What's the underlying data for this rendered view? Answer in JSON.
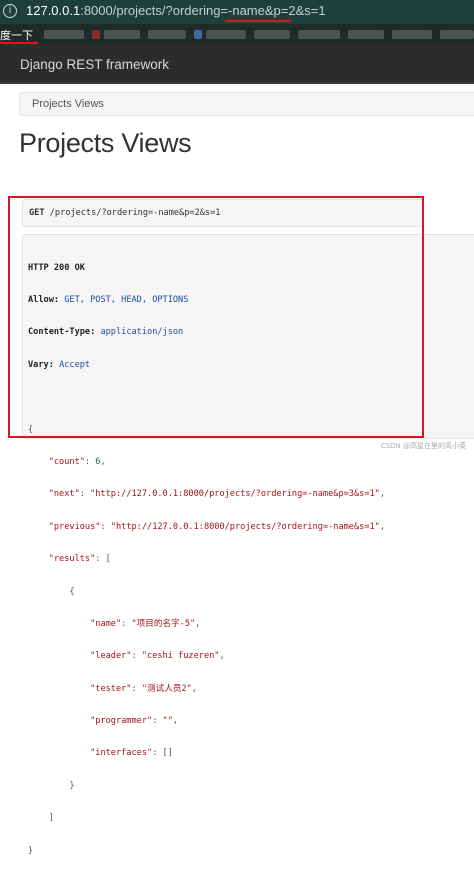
{
  "browser": {
    "url_host": "127.0.0.1",
    "url_path": ":8000/projects/?ordering=-name&p=2&s=1",
    "bookmark_first": "度一下"
  },
  "navbar": {
    "brand": "Django REST framework"
  },
  "breadcrumb": {
    "label": "Projects Views"
  },
  "page": {
    "title": "Projects Views"
  },
  "request": {
    "method": "GET",
    "path": "/projects/?ordering=-name&p=2&s=1"
  },
  "response": {
    "status_line": "HTTP 200 OK",
    "allow_key": "Allow:",
    "allow_value": "GET, POST, HEAD, OPTIONS",
    "content_type_key": "Content-Type:",
    "content_type_value": "application/json",
    "vary_key": "Vary:",
    "vary_value": "Accept",
    "body": {
      "count_key": "\"count\"",
      "count_value": "6",
      "next_key": "\"next\"",
      "next_value": "\"http://127.0.0.1:8000/projects/?ordering=-name&p=3&s=1\"",
      "previous_key": "\"previous\"",
      "previous_value": "\"http://127.0.0.1:8000/projects/?ordering=-name&s=1\"",
      "results_key": "\"results\"",
      "results": [
        {
          "name_key": "\"name\"",
          "name_value": "\"项目的名字-5\"",
          "leader_key": "\"leader\"",
          "leader_value": "\"ceshi fuzeren\"",
          "tester_key": "\"tester\"",
          "tester_value": "\"测试人员2\"",
          "programmer_key": "\"programmer\"",
          "programmer_value": "\"\"",
          "interfaces_key": "\"interfaces\"",
          "interfaces_value": "[]"
        }
      ]
    }
  },
  "watermark": "CSDN @高星在里的高小菜",
  "colors": {
    "highlight_red": "#e0141e",
    "navbar_bg": "#2c2c2c",
    "address_bar_bg": "#1f3f3a"
  }
}
